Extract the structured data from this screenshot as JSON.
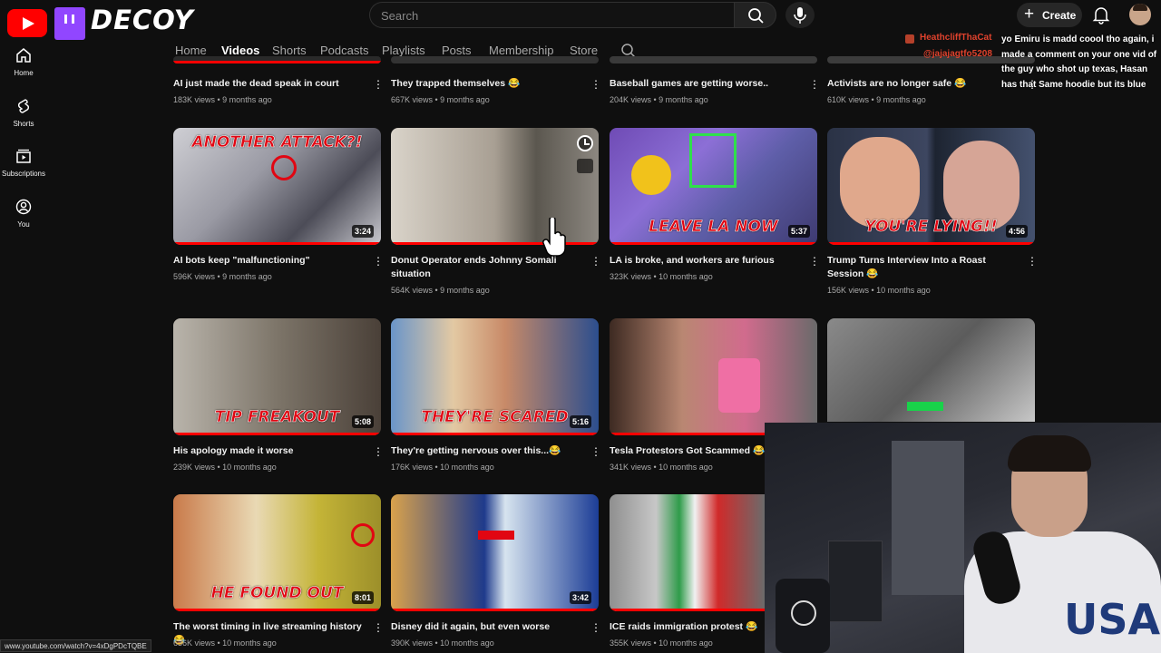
{
  "header": {
    "logo_text": "DECOY",
    "search_placeholder": "Search",
    "create_label": "Create",
    "plus_glyph": "+"
  },
  "sidebar": {
    "items": [
      {
        "label": "Home",
        "icon": "home-icon"
      },
      {
        "label": "Shorts",
        "icon": "shorts-icon"
      },
      {
        "label": "Subscriptions",
        "icon": "subscriptions-icon"
      },
      {
        "label": "You",
        "icon": "you-icon"
      }
    ]
  },
  "tabs": [
    {
      "label": "Home",
      "active": false
    },
    {
      "label": "Videos",
      "active": true
    },
    {
      "label": "Shorts",
      "active": false
    },
    {
      "label": "Podcasts",
      "active": false
    },
    {
      "label": "Playlists",
      "active": false
    },
    {
      "label": "Posts",
      "active": false
    },
    {
      "label": "Membership",
      "active": false
    },
    {
      "label": "Store",
      "active": false
    }
  ],
  "videos": [
    {
      "title": "AI just made the dead speak in court",
      "meta": "183K views • 9 months ago"
    },
    {
      "title": "They trapped themselves 😂",
      "meta": "667K views • 9 months ago"
    },
    {
      "title": "Baseball games are getting worse..",
      "meta": "204K views • 9 months ago"
    },
    {
      "title": "Activists are no longer safe 😂",
      "meta": "610K views • 9 months ago"
    },
    {
      "title": "AI bots keep \"malfunctioning\"",
      "meta": "596K views • 9 months ago",
      "duration": "3:24",
      "overlay": "ANOTHER ATTACK?!"
    },
    {
      "title": "Donut Operator ends Johnny Somali situation",
      "meta": "564K views • 9 months ago",
      "duration": ""
    },
    {
      "title": "LA is broke, and workers are furious",
      "meta": "323K views • 10 months ago",
      "duration": "5:37",
      "overlay": "LEAVE LA NOW"
    },
    {
      "title": "Trump Turns Interview Into a Roast Session 😂",
      "meta": "156K views • 10 months ago",
      "duration": "4:56",
      "overlay": "YOU'RE LYING!!"
    },
    {
      "title": "His apology made it worse",
      "meta": "239K views • 10 months ago",
      "duration": "5:08",
      "overlay": "TIP FREAKOUT"
    },
    {
      "title": "They're getting nervous over this...😂",
      "meta": "176K views • 10 months ago",
      "duration": "5:16",
      "overlay": "THEY'RE SCARED"
    },
    {
      "title": "Tesla Protestors Got Scammed 😂",
      "meta": "341K views • 10 months ago",
      "duration": ""
    },
    {
      "title": "",
      "meta": "",
      "duration": ""
    },
    {
      "title": "The worst timing in live streaming history 😂",
      "meta": "636K views • 10 months ago",
      "duration": "8:01",
      "overlay": "HE FOUND OUT"
    },
    {
      "title": "Disney did it again, but even worse",
      "meta": "390K views • 10 months ago",
      "duration": "3:42"
    },
    {
      "title": "ICE raids immigration protest 😂",
      "meta": "355K views • 10 months ago",
      "duration": ""
    }
  ],
  "chat": {
    "user1": "HeathcliffThaCat",
    "user2": "@jajajagtfo5208",
    "message": "yo Emiru is madd coool tho again, i made a comment on your one vid of the guy who shot up texas, Hasan has that Same hoodie but its blue"
  },
  "status_url": "www.youtube.com/watch?v=4xDgPDcTQBE",
  "colors": {
    "brand_red": "#ff0000",
    "twitch_purple": "#9146ff",
    "background": "#0f0f0f"
  }
}
